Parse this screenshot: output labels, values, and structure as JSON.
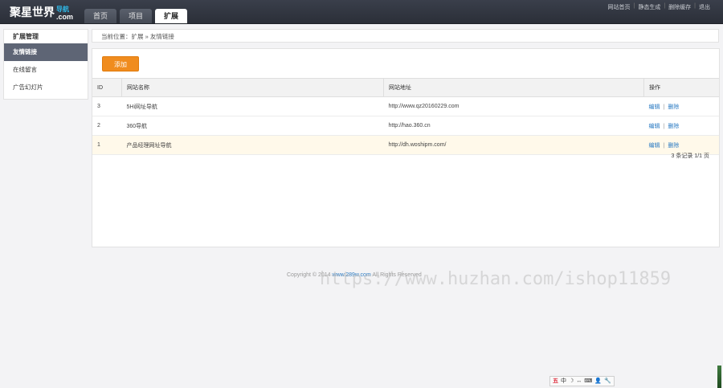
{
  "header": {
    "logo_main": "聚星世界",
    "logo_sub": "导航",
    "logo_domain": ".com",
    "tabs": [
      {
        "label": "首页",
        "active": false
      },
      {
        "label": "项目",
        "active": false
      },
      {
        "label": "扩展",
        "active": true
      }
    ],
    "links": [
      "网站首页",
      "静态生成",
      "删除缓存",
      "退出"
    ]
  },
  "sidebar": {
    "title": "扩展管理",
    "items": [
      {
        "label": "友情链接",
        "active": true
      },
      {
        "label": "在线留言",
        "active": false
      },
      {
        "label": "广告幻灯片",
        "active": false
      }
    ]
  },
  "breadcrumb": "当前位置：扩展 » 友情链接",
  "toolbar": {
    "add_label": "添加"
  },
  "table": {
    "headers": [
      "ID",
      "网站名称",
      "网站地址",
      "操作"
    ],
    "rows": [
      {
        "id": "3",
        "name": "5Hi网址导航",
        "url": "http://www.qz20160229.com",
        "edit": "编辑",
        "delete": "删除",
        "highlight": false
      },
      {
        "id": "2",
        "name": "360导航",
        "url": "http://hao.360.cn",
        "edit": "编辑",
        "delete": "删除",
        "highlight": false
      },
      {
        "id": "1",
        "name": "产品经理网址导航",
        "url": "http://dh.woshipm.com/",
        "edit": "编辑",
        "delete": "删除",
        "highlight": true
      }
    ]
  },
  "pagination": "3 条记录 1/1 页",
  "footer": {
    "copyright_prefix": "Copyright © 2014",
    "site": "www.289w.com",
    "rights": "All Rights Reserved"
  },
  "watermark": "https://www.huzhan.com/ishop11859",
  "ime_bar": [
    "五",
    "中",
    "☽",
    "↔",
    "⌨",
    "👤",
    "🔧"
  ],
  "colors": {
    "accent": "#f08c1e",
    "sidebar_active": "#5e6575",
    "link": "#2b7bc3",
    "topbar": "#2b2f38"
  }
}
